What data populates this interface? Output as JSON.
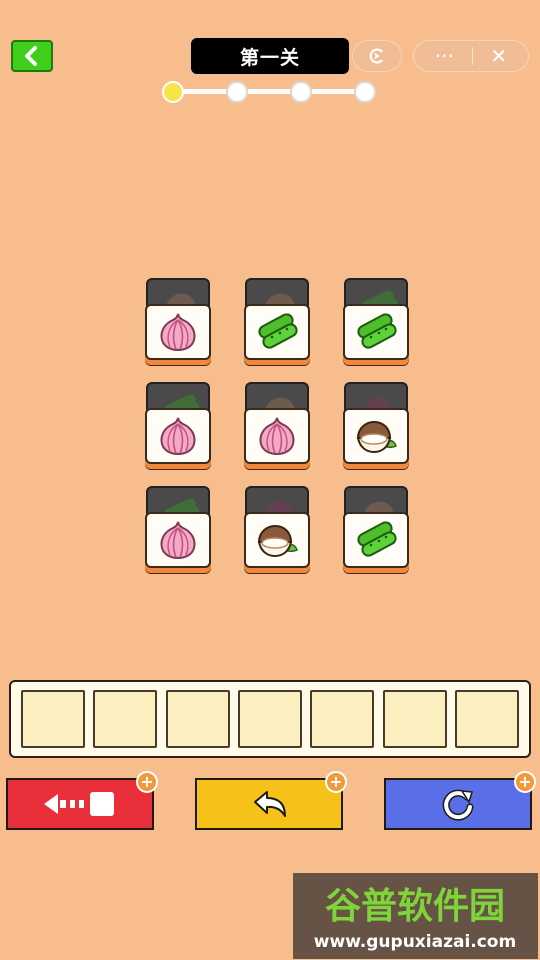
{
  "header": {
    "back_icon": "chevron-left-icon",
    "level_title": "第一关",
    "small_capsule_icon": "c-arrow-icon",
    "menu_dots": "···",
    "close_glyph": "✕"
  },
  "progress": {
    "current_stage": 1,
    "total_stages": 4
  },
  "board": {
    "rows": [
      [
        {
          "front": "onion",
          "back": "coconut"
        },
        {
          "front": "cucumber",
          "back": "coconut"
        },
        {
          "front": "cucumber",
          "back": "cucumber"
        }
      ],
      [
        {
          "front": "onion",
          "back": "cucumber"
        },
        {
          "front": "onion",
          "back": "coconut"
        },
        {
          "front": "coconut",
          "back": "onion"
        }
      ],
      [
        {
          "front": "onion",
          "back": "cucumber"
        },
        {
          "front": "coconut",
          "back": "onion"
        },
        {
          "front": "cucumber",
          "back": "coconut"
        }
      ]
    ]
  },
  "tray": {
    "slots": 7,
    "filled": 0
  },
  "actions": [
    {
      "id": "remove",
      "icon": "move-out-icon",
      "color": "#e9303a",
      "plus": "+"
    },
    {
      "id": "undo",
      "icon": "undo-icon",
      "color": "#f6c21a",
      "plus": "+"
    },
    {
      "id": "shuffle",
      "icon": "refresh-icon",
      "color": "#5a6ee8",
      "plus": "+"
    }
  ],
  "watermark": {
    "title": "谷普软件园",
    "url": "www.gupuxiazai.com"
  }
}
